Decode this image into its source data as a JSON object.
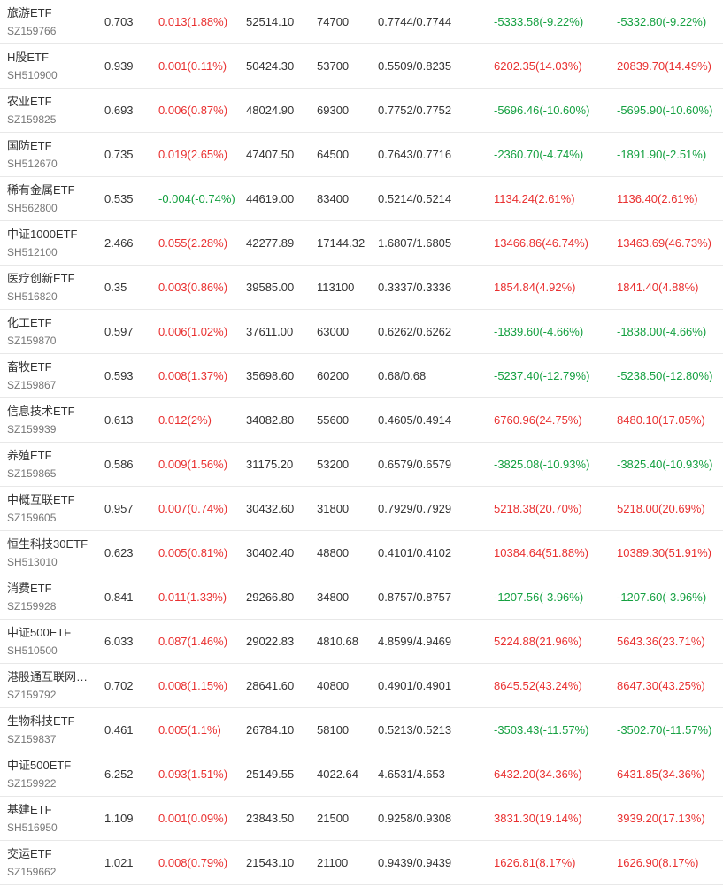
{
  "colors": {
    "up": "#e93030",
    "down": "#14a040",
    "text": "#333333",
    "code": "#777777"
  },
  "rows": [
    {
      "name": "旅游ETF",
      "code": "SZ159766",
      "price": "0.703",
      "change": "0.013(1.88%)",
      "change_dir": "up",
      "volume": "52514.10",
      "shares": "74700",
      "cost": "0.7744/0.7744",
      "pl1": "-5333.58(-9.22%)",
      "pl1_dir": "down",
      "pl2": "-5332.80(-9.22%)",
      "pl2_dir": "down"
    },
    {
      "name": "H股ETF",
      "code": "SH510900",
      "price": "0.939",
      "change": "0.001(0.11%)",
      "change_dir": "up",
      "volume": "50424.30",
      "shares": "53700",
      "cost": "0.5509/0.8235",
      "pl1": "6202.35(14.03%)",
      "pl1_dir": "up",
      "pl2": "20839.70(14.49%)",
      "pl2_dir": "up"
    },
    {
      "name": "农业ETF",
      "code": "SZ159825",
      "price": "0.693",
      "change": "0.006(0.87%)",
      "change_dir": "up",
      "volume": "48024.90",
      "shares": "69300",
      "cost": "0.7752/0.7752",
      "pl1": "-5696.46(-10.60%)",
      "pl1_dir": "down",
      "pl2": "-5695.90(-10.60%)",
      "pl2_dir": "down"
    },
    {
      "name": "国防ETF",
      "code": "SH512670",
      "price": "0.735",
      "change": "0.019(2.65%)",
      "change_dir": "up",
      "volume": "47407.50",
      "shares": "64500",
      "cost": "0.7643/0.7716",
      "pl1": "-2360.70(-4.74%)",
      "pl1_dir": "down",
      "pl2": "-1891.90(-2.51%)",
      "pl2_dir": "down"
    },
    {
      "name": "稀有金属ETF",
      "code": "SH562800",
      "price": "0.535",
      "change": "-0.004(-0.74%)",
      "change_dir": "down",
      "volume": "44619.00",
      "shares": "83400",
      "cost": "0.5214/0.5214",
      "pl1": "1134.24(2.61%)",
      "pl1_dir": "up",
      "pl2": "1136.40(2.61%)",
      "pl2_dir": "up"
    },
    {
      "name": "中证1000ETF",
      "code": "SH512100",
      "price": "2.466",
      "change": "0.055(2.28%)",
      "change_dir": "up",
      "volume": "42277.89",
      "shares": "17144.32",
      "cost": "1.6807/1.6805",
      "pl1": "13466.86(46.74%)",
      "pl1_dir": "up",
      "pl2": "13463.69(46.73%)",
      "pl2_dir": "up"
    },
    {
      "name": "医疗创新ETF",
      "code": "SH516820",
      "price": "0.35",
      "change": "0.003(0.86%)",
      "change_dir": "up",
      "volume": "39585.00",
      "shares": "113100",
      "cost": "0.3337/0.3336",
      "pl1": "1854.84(4.92%)",
      "pl1_dir": "up",
      "pl2": "1841.40(4.88%)",
      "pl2_dir": "up"
    },
    {
      "name": "化工ETF",
      "code": "SZ159870",
      "price": "0.597",
      "change": "0.006(1.02%)",
      "change_dir": "up",
      "volume": "37611.00",
      "shares": "63000",
      "cost": "0.6262/0.6262",
      "pl1": "-1839.60(-4.66%)",
      "pl1_dir": "down",
      "pl2": "-1838.00(-4.66%)",
      "pl2_dir": "down"
    },
    {
      "name": "畜牧ETF",
      "code": "SZ159867",
      "price": "0.593",
      "change": "0.008(1.37%)",
      "change_dir": "up",
      "volume": "35698.60",
      "shares": "60200",
      "cost": "0.68/0.68",
      "pl1": "-5237.40(-12.79%)",
      "pl1_dir": "down",
      "pl2": "-5238.50(-12.80%)",
      "pl2_dir": "down"
    },
    {
      "name": "信息技术ETF",
      "code": "SZ159939",
      "price": "0.613",
      "change": "0.012(2%)",
      "change_dir": "up",
      "volume": "34082.80",
      "shares": "55600",
      "cost": "0.4605/0.4914",
      "pl1": "6760.96(24.75%)",
      "pl1_dir": "up",
      "pl2": "8480.10(17.05%)",
      "pl2_dir": "up"
    },
    {
      "name": "养殖ETF",
      "code": "SZ159865",
      "price": "0.586",
      "change": "0.009(1.56%)",
      "change_dir": "up",
      "volume": "31175.20",
      "shares": "53200",
      "cost": "0.6579/0.6579",
      "pl1": "-3825.08(-10.93%)",
      "pl1_dir": "down",
      "pl2": "-3825.40(-10.93%)",
      "pl2_dir": "down"
    },
    {
      "name": "中概互联ETF",
      "code": "SZ159605",
      "price": "0.957",
      "change": "0.007(0.74%)",
      "change_dir": "up",
      "volume": "30432.60",
      "shares": "31800",
      "cost": "0.7929/0.7929",
      "pl1": "5218.38(20.70%)",
      "pl1_dir": "up",
      "pl2": "5218.00(20.69%)",
      "pl2_dir": "up"
    },
    {
      "name": "恒生科技30ETF",
      "code": "SH513010",
      "price": "0.623",
      "change": "0.005(0.81%)",
      "change_dir": "up",
      "volume": "30402.40",
      "shares": "48800",
      "cost": "0.4101/0.4102",
      "pl1": "10384.64(51.88%)",
      "pl1_dir": "up",
      "pl2": "10389.30(51.91%)",
      "pl2_dir": "up"
    },
    {
      "name": "消费ETF",
      "code": "SZ159928",
      "price": "0.841",
      "change": "0.011(1.33%)",
      "change_dir": "up",
      "volume": "29266.80",
      "shares": "34800",
      "cost": "0.8757/0.8757",
      "pl1": "-1207.56(-3.96%)",
      "pl1_dir": "down",
      "pl2": "-1207.60(-3.96%)",
      "pl2_dir": "down"
    },
    {
      "name": "中证500ETF",
      "code": "SH510500",
      "price": "6.033",
      "change": "0.087(1.46%)",
      "change_dir": "up",
      "volume": "29022.83",
      "shares": "4810.68",
      "cost": "4.8599/4.9469",
      "pl1": "5224.88(21.96%)",
      "pl1_dir": "up",
      "pl2": "5643.36(23.71%)",
      "pl2_dir": "up"
    },
    {
      "name": "港股通互联网…",
      "code": "SZ159792",
      "price": "0.702",
      "change": "0.008(1.15%)",
      "change_dir": "up",
      "volume": "28641.60",
      "shares": "40800",
      "cost": "0.4901/0.4901",
      "pl1": "8645.52(43.24%)",
      "pl1_dir": "up",
      "pl2": "8647.30(43.25%)",
      "pl2_dir": "up"
    },
    {
      "name": "生物科技ETF",
      "code": "SZ159837",
      "price": "0.461",
      "change": "0.005(1.1%)",
      "change_dir": "up",
      "volume": "26784.10",
      "shares": "58100",
      "cost": "0.5213/0.5213",
      "pl1": "-3503.43(-11.57%)",
      "pl1_dir": "down",
      "pl2": "-3502.70(-11.57%)",
      "pl2_dir": "down"
    },
    {
      "name": "中证500ETF",
      "code": "SZ159922",
      "price": "6.252",
      "change": "0.093(1.51%)",
      "change_dir": "up",
      "volume": "25149.55",
      "shares": "4022.64",
      "cost": "4.6531/4.653",
      "pl1": "6432.20(34.36%)",
      "pl1_dir": "up",
      "pl2": "6431.85(34.36%)",
      "pl2_dir": "up"
    },
    {
      "name": "基建ETF",
      "code": "SH516950",
      "price": "1.109",
      "change": "0.001(0.09%)",
      "change_dir": "up",
      "volume": "23843.50",
      "shares": "21500",
      "cost": "0.9258/0.9308",
      "pl1": "3831.30(19.14%)",
      "pl1_dir": "up",
      "pl2": "3939.20(17.13%)",
      "pl2_dir": "up"
    },
    {
      "name": "交运ETF",
      "code": "SZ159662",
      "price": "1.021",
      "change": "0.008(0.79%)",
      "change_dir": "up",
      "volume": "21543.10",
      "shares": "21100",
      "cost": "0.9439/0.9439",
      "pl1": "1626.81(8.17%)",
      "pl1_dir": "up",
      "pl2": "1626.90(8.17%)",
      "pl2_dir": "up"
    }
  ]
}
